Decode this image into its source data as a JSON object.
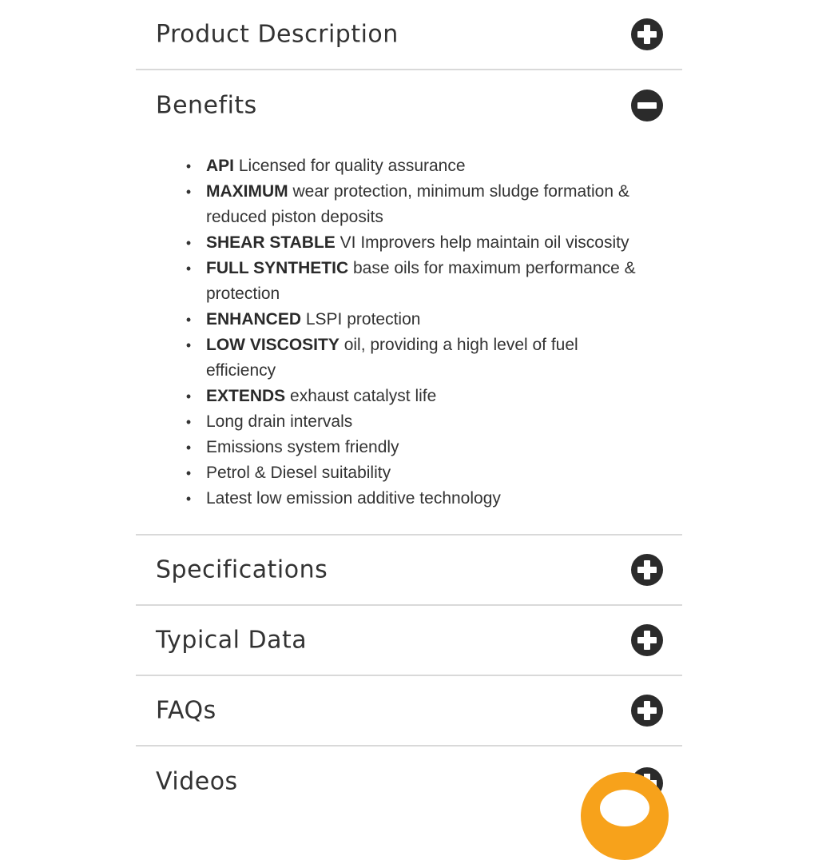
{
  "sections": {
    "product_description": {
      "title": "Product Description",
      "state": "collapsed",
      "icon": "plus-icon"
    },
    "benefits": {
      "title": "Benefits",
      "state": "expanded",
      "icon": "minus-icon"
    },
    "specifications": {
      "title": "Specifications",
      "state": "collapsed",
      "icon": "plus-icon"
    },
    "typical_data": {
      "title": "Typical Data",
      "state": "collapsed",
      "icon": "plus-icon"
    },
    "faqs": {
      "title": "FAQs",
      "state": "collapsed",
      "icon": "plus-icon"
    },
    "videos": {
      "title": "Videos",
      "state": "collapsed",
      "icon": "plus-icon"
    }
  },
  "benefits_list": [
    {
      "bold": "API",
      "rest": "Licensed for quality assurance"
    },
    {
      "bold": "MAXIMUM",
      "rest": "wear protection, minimum sludge formation &",
      "rest2": "reduced piston deposits"
    },
    {
      "bold": "SHEAR STABLE",
      "rest": "VI Improvers help maintain oil viscosity"
    },
    {
      "bold": "FULL SYNTHETIC",
      "rest": "base oils for maximum performance &",
      "rest2": "protection"
    },
    {
      "bold": "ENHANCED",
      "rest": "LSPI protection"
    },
    {
      "bold": "LOW VISCOSITY",
      "rest": "oil, providing a high level of fuel",
      "rest2": "efficiency"
    },
    {
      "bold": "EXTENDS",
      "rest": "exhaust catalyst life"
    },
    {
      "bold": "",
      "rest": "Long drain intervals"
    },
    {
      "bold": "",
      "rest": "Emissions system friendly"
    },
    {
      "bold": "",
      "rest": "Petrol & Diesel suitability"
    },
    {
      "bold": "",
      "rest": "Latest low emission additive technology"
    }
  ],
  "chat_button": {
    "icon": "chat-bubble-icon",
    "color": "#f7a21b"
  },
  "colors": {
    "icon_dark": "#2b2b2b",
    "divider": "#d9d9d9",
    "text": "#333333"
  }
}
